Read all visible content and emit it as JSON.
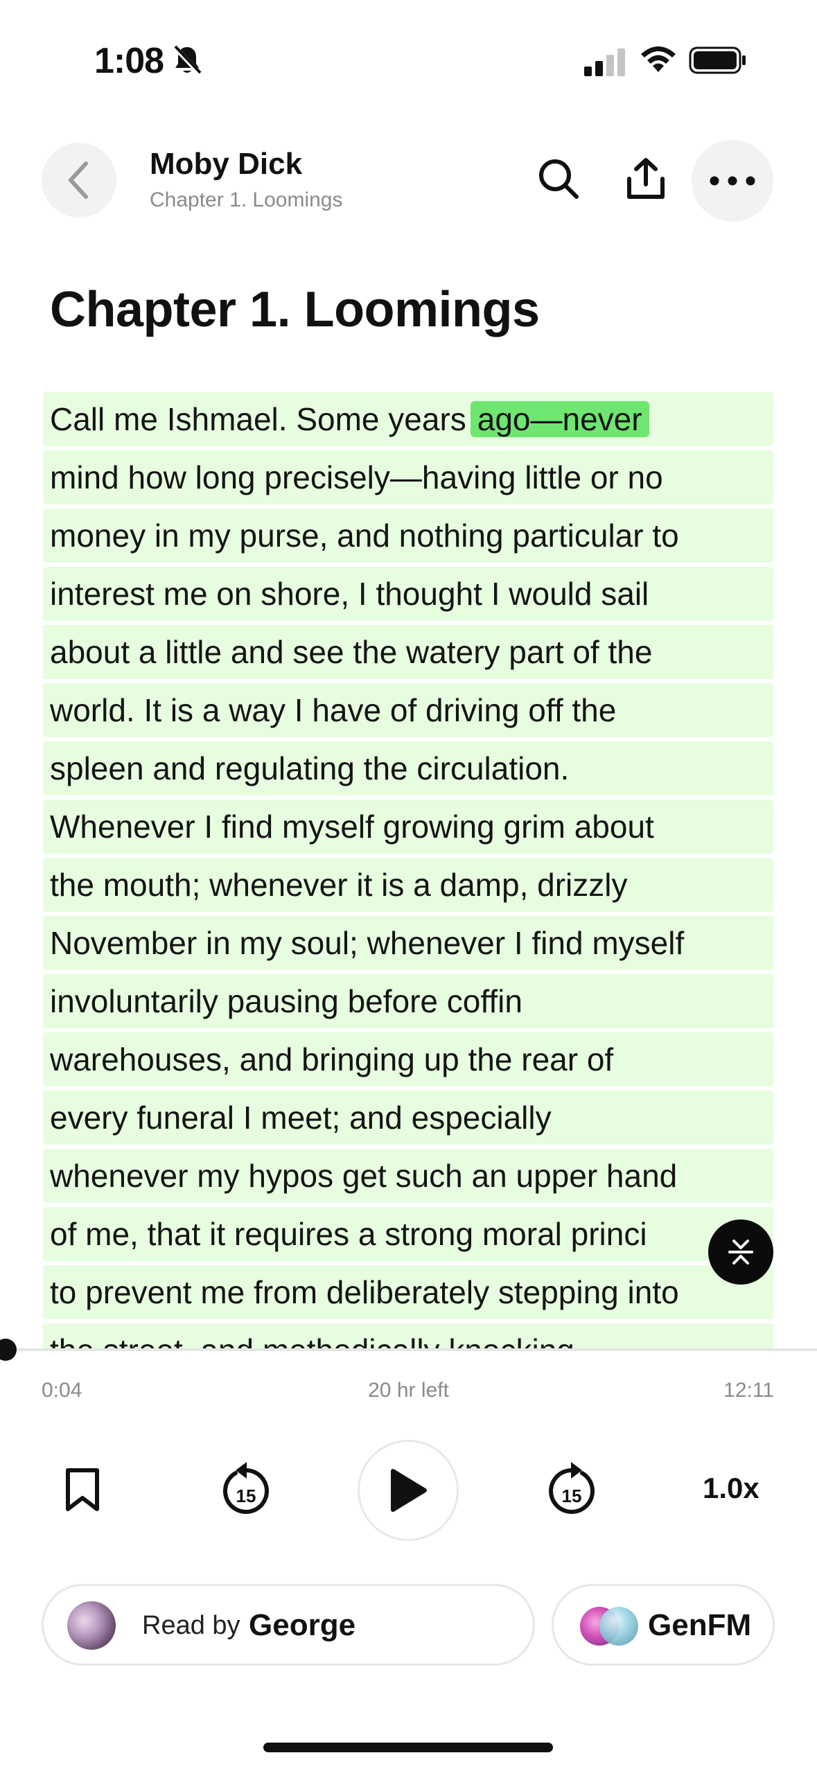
{
  "status_bar": {
    "time": "1:08",
    "icons": [
      "bell-slash-icon",
      "signal-icon",
      "wifi-icon",
      "battery-icon"
    ]
  },
  "header": {
    "book_title": "Moby Dick",
    "chapter_subtitle": "Chapter 1. Loomings",
    "icons": [
      "chevron-left-icon",
      "search-icon",
      "share-icon",
      "more-icon"
    ]
  },
  "chapter": {
    "heading": "Chapter 1. Loomings",
    "lines": [
      "Call me Ishmael. Some years",
      "mind how long precisely—having little or no",
      "money in my purse, and nothing particular to",
      "interest me on shore, I thought I would sail",
      "about a little and see the watery part of the",
      "world. It is a way I have of driving off the",
      "spleen and regulating the circulation.",
      "Whenever I find myself growing grim about",
      "the mouth; whenever it is a damp, drizzly",
      "November in my soul; whenever I find myself",
      "involuntarily pausing before coffin",
      "warehouses, and bringing up the rear of",
      "every funeral I meet; and especially",
      "whenever my hypos get such an upper hand",
      "of me, that it requires a strong moral princi",
      "to prevent me from deliberately stepping into",
      "the street, and methodically knocking"
    ],
    "highlighted_word": "ago—never",
    "highlight_color": "#6ee670",
    "sentence_highlight_color": "#e6fddf"
  },
  "progress": {
    "elapsed": "0:04",
    "remaining": "20 hr left",
    "total": "12:11"
  },
  "controls": {
    "rewind_seconds": "15",
    "forward_seconds": "15",
    "speed": "1.0x",
    "icons": [
      "bookmark-icon",
      "rewind-15-icon",
      "play-icon",
      "forward-15-icon"
    ]
  },
  "voice": {
    "label": "Read by",
    "name": "George"
  },
  "genfm": {
    "label": "GenFM"
  }
}
